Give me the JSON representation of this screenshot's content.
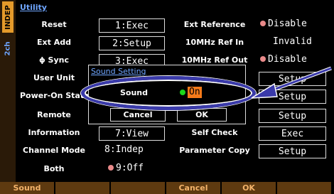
{
  "sidebar": {
    "mode_tag": "INDEP",
    "channel_tag": "2ch"
  },
  "screen_title": "Utility",
  "left_column": [
    {
      "label": "Reset",
      "value": "1:Exec",
      "boxed": true
    },
    {
      "label": "Ext Add",
      "value": "2:Setup",
      "boxed": true
    },
    {
      "label": "ϕ Sync",
      "value": "3:Exec",
      "boxed": true
    },
    {
      "label": "User Unit",
      "value": "",
      "boxed": false
    },
    {
      "label": "Power-On State",
      "value": "",
      "boxed": false
    },
    {
      "label": "Remote",
      "value": "",
      "boxed": false
    },
    {
      "label": "Information",
      "value": "7:View",
      "boxed": true
    },
    {
      "label": "Channel Mode",
      "value": "8:Indep",
      "boxed": false
    },
    {
      "label": "Both",
      "value": "9:Off",
      "boxed": false
    }
  ],
  "right_column": [
    {
      "label": "Ext Reference",
      "value": "Disable",
      "indicator": "dot"
    },
    {
      "label": "10MHz Ref In",
      "value": "Invalid",
      "indicator": ""
    },
    {
      "label": "10MHz Ref Out",
      "value": "Disable",
      "indicator": "dot"
    },
    {
      "label": "",
      "value": "Setup",
      "indicator": "box"
    },
    {
      "label": "",
      "value": "Setup",
      "indicator": "box"
    },
    {
      "label": "",
      "value": "Setup",
      "indicator": "box"
    },
    {
      "label": "Self Check",
      "value": "Exec",
      "indicator": "box"
    },
    {
      "label": "Parameter Copy",
      "value": "Setup",
      "indicator": "box"
    }
  ],
  "dialog": {
    "title": "Sound Setting",
    "field_label": "Sound",
    "field_value": "On",
    "cancel_label": "Cancel",
    "ok_label": "OK"
  },
  "softkeys": [
    "Sound",
    "",
    "",
    "Cancel",
    "OK",
    ""
  ],
  "colors": {
    "accent_orange": "#f57a1a",
    "title_blue": "#6fa6ff",
    "softkey_bg": "#5e3a10",
    "highlight_ring": "#3a3aaa"
  }
}
